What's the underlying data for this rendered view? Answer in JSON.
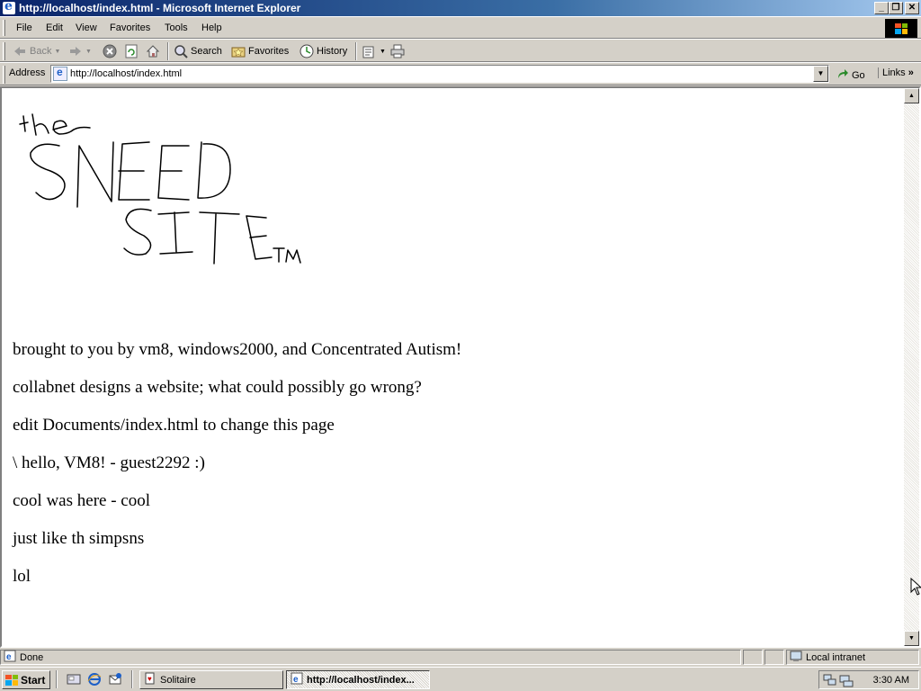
{
  "window": {
    "title": "http://localhost/index.html - Microsoft Internet Explorer",
    "buttons": [
      "minimize",
      "restore",
      "close"
    ]
  },
  "menu": {
    "items": [
      "File",
      "Edit",
      "View",
      "Favorites",
      "Tools",
      "Help"
    ]
  },
  "toolbar": {
    "back_label": "Back",
    "search_label": "Search",
    "favorites_label": "Favorites",
    "history_label": "History"
  },
  "address": {
    "label": "Address",
    "url": "http://localhost/index.html",
    "go_label": "Go",
    "links_label": "Links"
  },
  "page": {
    "logo_text": {
      "line1": "the",
      "line2": "SNEED",
      "line3": "SITE",
      "mark": "TM"
    },
    "paragraphs": [
      "brought to you by vm8, windows2000, and Concentrated Autism!",
      "collabnet designs a website; what could possibly go wrong?",
      "edit Documents/index.html to change this page",
      "\\ hello, VM8! - guest2292 :)",
      "cool was here - cool",
      "just like th simpsns",
      "lol"
    ]
  },
  "status": {
    "text": "Done",
    "zone": "Local intranet"
  },
  "taskbar": {
    "start_label": "Start",
    "tasks": [
      "Solitaire",
      "http://localhost/index..."
    ],
    "clock": "3:30 AM"
  },
  "colors": {
    "title_active": "#0a246a",
    "title_gradient_end": "#a6caf0",
    "chrome": "#d4d0c8"
  }
}
